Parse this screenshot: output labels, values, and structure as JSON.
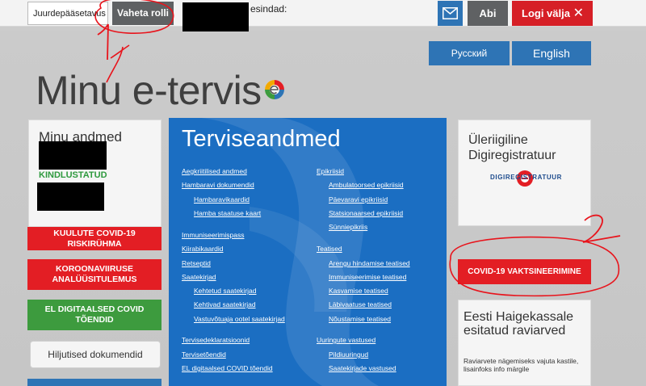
{
  "topbar": {
    "role_select_value": "Juurdepääsetavus",
    "switch_role_label": "Vaheta rolli",
    "representatives_label": "esindad:",
    "help_label": "Abi",
    "logout_label": "Logi välja",
    "icons": {
      "mail": "mail-icon",
      "close": "close-icon"
    }
  },
  "languages": {
    "russian": "Русский",
    "english": "English"
  },
  "logo": {
    "text": "Minu e-tervis"
  },
  "left": {
    "title": "Minu andmed",
    "insurance_status": "KINDLUSTATUD",
    "covid_risk_label": "KUULUTE COVID-19 RISKIRÜHMA",
    "covid_analysis_label": "KOROONAVIIRUSE ANALÜÜSITULEMUS",
    "digital_cert_label": "EL DIGITAALSED COVID TÕENDID",
    "hidden_docs_label": "Hiljutised dokumendid"
  },
  "center": {
    "title": "Terviseandmed",
    "links": {
      "c1": "Aegkriitilised andmed",
      "c2": "Hambaravi dokumendid",
      "c3": "Hambaravikaardid",
      "c4": "Hamba staatuse kaart",
      "c5": "Immuniseerimispass",
      "c6": "Kiirabikaardid",
      "c7": "Retseptid",
      "c8": "Saatekirjad",
      "c9": "Kehtetud saatekirjad",
      "c10": "Kehtivad saatekirjad",
      "c11": "Vastuvõtuaja ootel saatekirjad",
      "c12": "Tervisedeklaratsioonid",
      "c13": "Tervisetõendid",
      "c14": "EL digitaalsed COVID tõendid",
      "r1": "Epikriisid",
      "r2": "Ambulatoorsed epikriisid",
      "r3": "Päevaravi epikriisid",
      "r4": "Statsionaarsed epikriisid",
      "r5": "Sünniepikriis",
      "r6": "Teatised",
      "r7": "Arengu hindamise teatised",
      "r8": "Immuniseerimise teatised",
      "r9": "Kasvamise teatised",
      "r10": "Läbivaatuse teatised",
      "r11": "Nõustamise teatised",
      "r12": "Uuringute vastused",
      "r13": "Pildiuuringud",
      "r14": "Saatekirjade vastused"
    }
  },
  "right": {
    "title": "Üleriigiline Digiregistratuur",
    "digi_logo_text": "DIGIREGISTRATUUR",
    "covid_vacc_label": "COVID-19 VAKTSINEERIMINE",
    "eesti_title": "Eesti Haigekassale esitatud raviarved",
    "eesti_sub": "Raviarvete nägemiseks vajuta kastile, lisainfoks info märgile"
  },
  "annotations": {
    "number_1": "1",
    "number_2": "2"
  },
  "colors": {
    "blue": "#2e74b5",
    "red": "#e31e24",
    "green": "#3d9b3e",
    "panel_blue": "#1b6ec2",
    "annotation_red": "#e8141c"
  }
}
